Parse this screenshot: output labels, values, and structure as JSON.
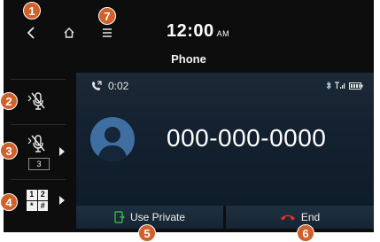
{
  "status_bar": {
    "time": "12:00",
    "ampm": "AM"
  },
  "screen_title": "Phone",
  "call": {
    "duration": "0:02",
    "number": "000-000-0000"
  },
  "rail": {
    "mic_count": "3",
    "keypad_digits": [
      "1",
      "2",
      "*",
      "#"
    ]
  },
  "actions": {
    "use_private_label": "Use Private",
    "end_label": "End"
  },
  "callouts": [
    "1",
    "2",
    "3",
    "4",
    "5",
    "6",
    "7"
  ],
  "colors": {
    "badge": "#d1612b",
    "end_icon": "#e0302a",
    "private_icon": "#39b24a",
    "avatar": "#3f6fa0",
    "background": "#0d0d0d"
  }
}
